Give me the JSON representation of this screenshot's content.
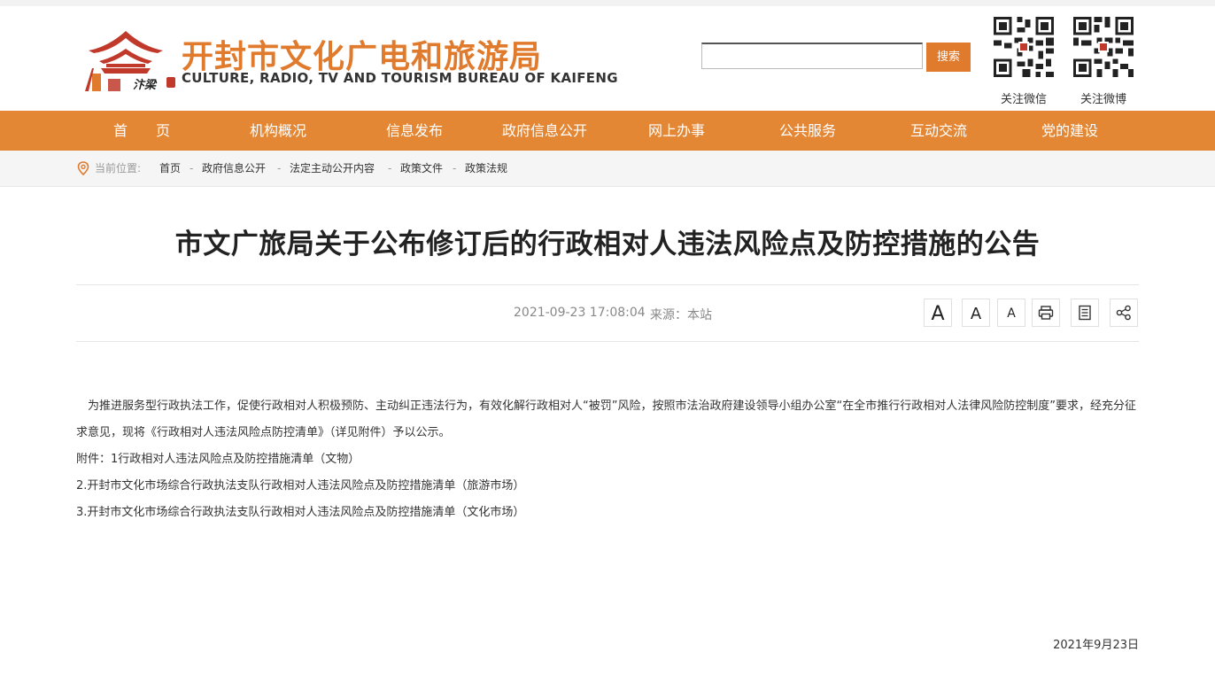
{
  "header": {
    "title": "开封市文化广电和旅游局",
    "subtitle": "CULTURE, RADIO, TV AND TOURISM BUREAU OF KAIFENG",
    "logo_script": "汴梁",
    "search": {
      "placeholder": "",
      "button_label": "搜索"
    },
    "qr": [
      {
        "label": "关注微信",
        "icon": "qr-code-icon"
      },
      {
        "label": "关注微博",
        "icon": "qr-code-icon"
      }
    ]
  },
  "nav": {
    "items": [
      "首　　页",
      "机构概况",
      "信息发布",
      "政府信息公开",
      "网上办事",
      "公共服务",
      "互动交流",
      "党的建设"
    ]
  },
  "breadcrumb": {
    "label": "当前位置:",
    "items": [
      "首页",
      "政府信息公开",
      "法定主动公开内容",
      "政策文件",
      "政策法规"
    ],
    "separator": "-"
  },
  "article": {
    "title": "市文广旅局关于公布修订后的行政相对人违法风险点及防控措施的公告",
    "datetime": "2021-09-23 17:08:04",
    "source": "来源：本站",
    "tools": [
      {
        "label": "A",
        "icon": "font-large-icon"
      },
      {
        "label": "A",
        "icon": "font-medium-icon"
      },
      {
        "label": "A",
        "icon": "font-small-icon"
      },
      {
        "label": "",
        "icon": "print-icon"
      },
      {
        "label": "",
        "icon": "document-icon"
      },
      {
        "label": "",
        "icon": "share-icon"
      }
    ],
    "paragraphs": [
      "为推进服务型行政执法工作，促使行政相对人积极预防、主动纠正违法行为，有效化解行政相对人“被罚”风险，按照市法治政府建设领导小组办公室“在全市推行行政相对人法律风险防控制度”要求，经充分征求意见，现将《行政相对人违法风险点防控清单》（详见附件）予以公示。",
      "附件：1行政相对人违法风险点及防控措施清单（文物）",
      "2.开封市文化市场综合行政执法支队行政相对人违法风险点及防控措施清单（旅游市场）",
      "3.开封市文化市场综合行政执法支队行政相对人违法风险点及防控措施清单（文化市场）"
    ],
    "date_end": "2021年9月23日"
  },
  "colors": {
    "accent": "#e07b2e",
    "nav_bg": "#e48735",
    "logo_red": "#c0392b"
  }
}
